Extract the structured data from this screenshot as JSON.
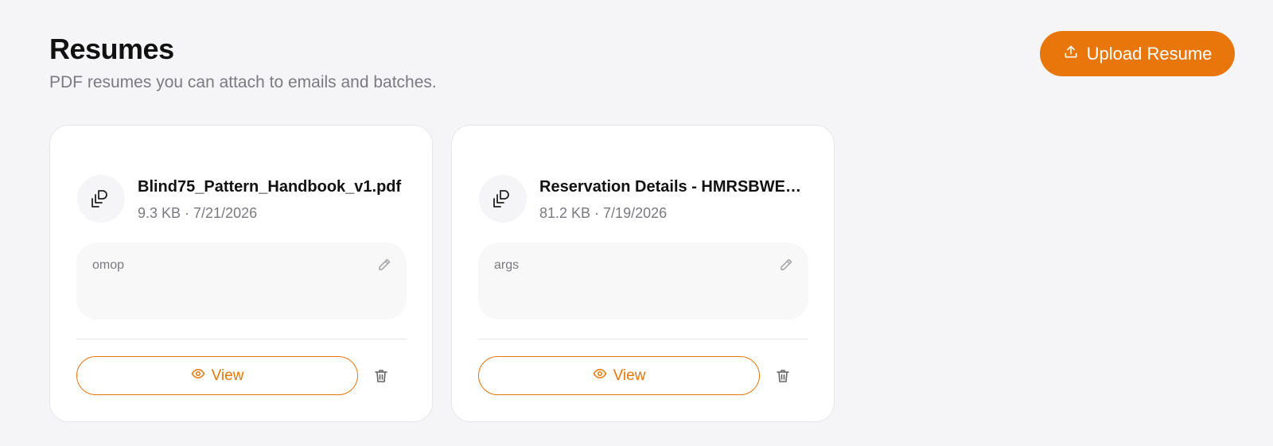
{
  "header": {
    "title": "Resumes",
    "subtitle": "PDF resumes you can attach to emails and batches."
  },
  "upload_button": {
    "label": "Upload Resume",
    "icon": "upload-icon"
  },
  "colors": {
    "accent": "#e8760a",
    "background": "#f5f5f7",
    "muted_text": "#7a7a80"
  },
  "resumes": [
    {
      "file_name": "Blind75_Pattern_Handbook_v1.pdf",
      "meta": "9.3 KB · 7/21/2026",
      "note": "omop",
      "view_label": "View"
    },
    {
      "file_name": "Reservation Details - HMRSBWED...",
      "meta": "81.2 KB · 7/19/2026",
      "note": "args",
      "view_label": "View"
    }
  ]
}
